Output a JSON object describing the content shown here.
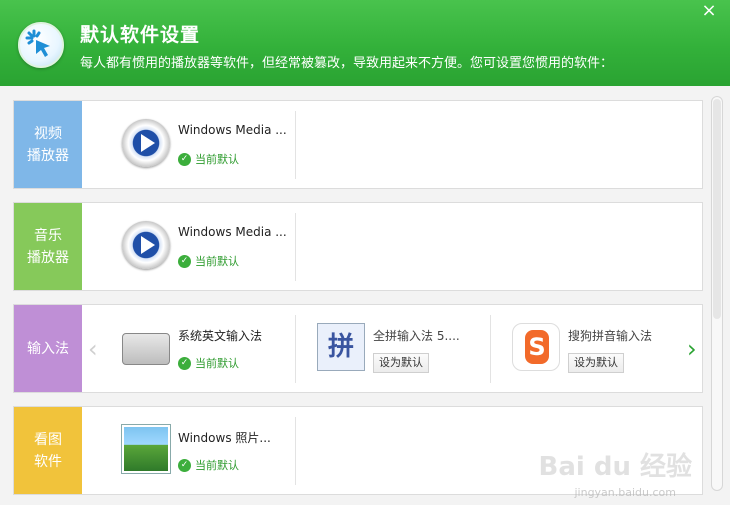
{
  "header": {
    "title": "默认软件设置",
    "subtitle": "每人都有惯用的播放器等软件，但经常被篡改，导致用起来不方便。您可设置您惯用的软件：",
    "close_glyph": "×"
  },
  "rows": [
    {
      "category": "视频\n播放器",
      "items": [
        {
          "name": "Windows Media ...",
          "status": "当前默认",
          "icon": "windows-media-player-icon"
        }
      ]
    },
    {
      "category": "音乐\n播放器",
      "items": [
        {
          "name": "Windows Media ...",
          "status": "当前默认",
          "icon": "windows-media-player-icon"
        }
      ]
    },
    {
      "category": "输入法",
      "items": [
        {
          "name": "系统英文输入法",
          "status": "当前默认",
          "icon": "keyboard-icon"
        },
        {
          "name": "全拼输入法 5....",
          "button": "设为默认",
          "icon": "quanpin-ime-icon",
          "icon_text": "拼"
        },
        {
          "name": "搜狗拼音输入法",
          "button": "设为默认",
          "icon": "sogou-ime-icon"
        }
      ],
      "prev_arrow": "‹",
      "next_arrow": "›"
    },
    {
      "category": "看图\n软件",
      "items": [
        {
          "name": "Windows 照片...",
          "status": "当前默认",
          "icon": "windows-photo-viewer-icon"
        }
      ]
    }
  ],
  "watermark": {
    "logo": "Bai du 经验",
    "url": "jingyan.baidu.com"
  },
  "colors": {
    "header_green": "#33b13a",
    "video_tab": "#7fb7e8",
    "music_tab": "#86c95a",
    "ime_tab": "#bf8fd6",
    "image_tab": "#f1c33b",
    "status_green": "#2e9b2e"
  }
}
